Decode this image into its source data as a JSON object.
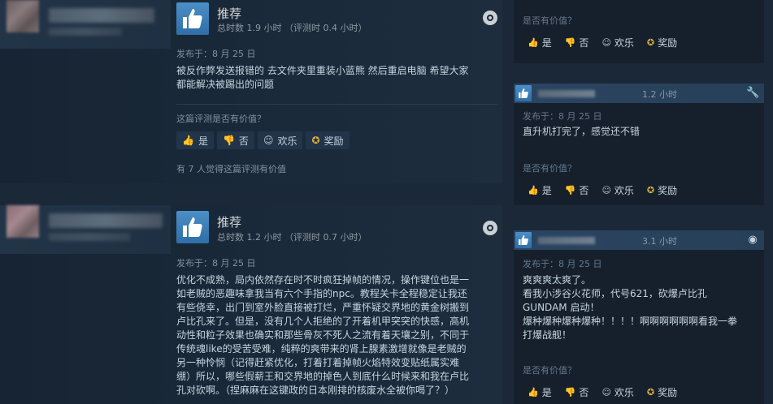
{
  "reviews": [
    {
      "verdict": "推荐",
      "hours": "总时数 1.9 小时 （评测时 0.4 小时）",
      "posted": "发布于：8 月 25 日",
      "body": "被反作弊发送报错的 去文件夹里重装小蓝熊 然后重启电脑 希望大家\n都能解决被踢出的问题",
      "helpful_question": "这篇评测是否有价值？",
      "vote_yes": "是",
      "vote_no": "否",
      "vote_funny": "欢乐",
      "vote_award": "奖励",
      "helpful_count": "有 7 人觉得这篇评测有价值"
    },
    {
      "verdict": "推荐",
      "hours": "总时数 1.2 小时 （评测时 0.7 小时）",
      "posted": "发布于：8 月 25 日",
      "body": "优化不成熟，局内依然存在时不时疯狂掉帧的情况，操作键位也是一\n如老贼的恶趣味拿我当有六个手指的npc。教程关卡全程稳定让我还\n有些侥幸，出门到室外脸直接被打烂，严重怀疑交界地的黄金树搬到\n卢比孔来了。但是，没有几个人拒绝的了开着机甲突突的快感，高机\n动性和粒子效果也确实和那些骨灰不死人之流有着天壤之别，不同于\n传统魂like的受苦受难，纯粹的爽带来的肾上腺素激增就像是老贼的\n另一种怜悯（记得赶紧优化，打着打着掉帧火焰特效变贴纸属实难\n绷）所以，哪些假薪王和交界地的掉色人到底什么时候来和我在卢比\n孔对砍啊。（捏麻麻在这键政的日本刚排的核废水全被你喝了？）"
    }
  ],
  "comments": [
    {
      "helpful_question": "是否有价值？",
      "vote_yes": "是",
      "vote_no": "否",
      "vote_funny": "欢乐",
      "vote_award": "奖励"
    },
    {
      "hours": "1.2 小时",
      "posted": "发布于：8 月 25 日",
      "text": "直升机打完了，感觉还不错",
      "helpful_question": "是否有价值？",
      "vote_yes": "是",
      "vote_no": "否",
      "vote_funny": "欢乐",
      "vote_award": "奖励"
    },
    {
      "hours": "3.1 小时",
      "posted": "发布于：8 月 25 日",
      "text": "爽爽爽太爽了。\n看我小涉谷火花师，代号621，砍爆卢比孔\nGUNDAM 启动！\n爆种爆种爆种爆种！！！！啊啊啊啊啊啊看我一拳\n打爆战舰！",
      "helpful_question": "是否有价值？",
      "vote_yes": "是",
      "vote_no": "否",
      "vote_funny": "欢乐",
      "vote_award": "奖励"
    }
  ],
  "icons": {
    "thumbs_up": "thumbs-up-icon",
    "thumbs_down": "thumbs-down-icon",
    "funny": "smiley-icon",
    "award": "award-icon",
    "platform": "steam-icon",
    "wrench": "wrench-icon"
  },
  "colors": {
    "background": "#1b2838",
    "accent_blue": "#4b8fc6",
    "award_gold": "#e2b23d"
  }
}
